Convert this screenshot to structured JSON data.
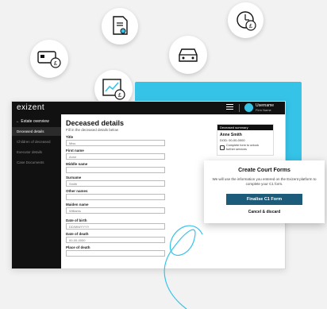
{
  "app": {
    "logo": "exizent",
    "user": {
      "name": "Username",
      "org": "Firm Name"
    }
  },
  "sidebar": {
    "back": "← Estate overview",
    "items": [
      {
        "label": "Deceased details",
        "active": true
      },
      {
        "label": "Children of deceased",
        "active": false
      },
      {
        "label": "Executor details",
        "active": false
      },
      {
        "label": "Case Documents",
        "active": false
      }
    ]
  },
  "main": {
    "title": "Deceased details",
    "subtitle": "Fill in the deceased details below",
    "fields": [
      {
        "label": "Title",
        "value": "Miss"
      },
      {
        "label": "First name",
        "value": "Anne"
      },
      {
        "label": "Middle name",
        "value": ""
      },
      {
        "label": "Surname",
        "value": "Smith"
      },
      {
        "label": "Other names",
        "value": ""
      },
      {
        "label": "Maiden name",
        "value": "Williams"
      },
      {
        "label": "Date of birth",
        "value": "DD/MM/YYYY"
      },
      {
        "label": "Date of death",
        "value": "00-00-0000"
      },
      {
        "label": "Place of death",
        "value": ""
      }
    ]
  },
  "summary": {
    "header": "Deceased summary",
    "name": "Anne Smith",
    "dod": "DOD: 00-00-0000",
    "note": "Complete form to unlock further services"
  },
  "dialog": {
    "title": "Create Court Forms",
    "body": "We will use the information you entered on the Exizent platform to complete your C1 form.",
    "primary": "Finalise C1 Form",
    "secondary": "Cancel & discard"
  },
  "colors": {
    "accent": "#36c3e8",
    "primary_button": "#1d5b7a",
    "dark": "#111111"
  }
}
